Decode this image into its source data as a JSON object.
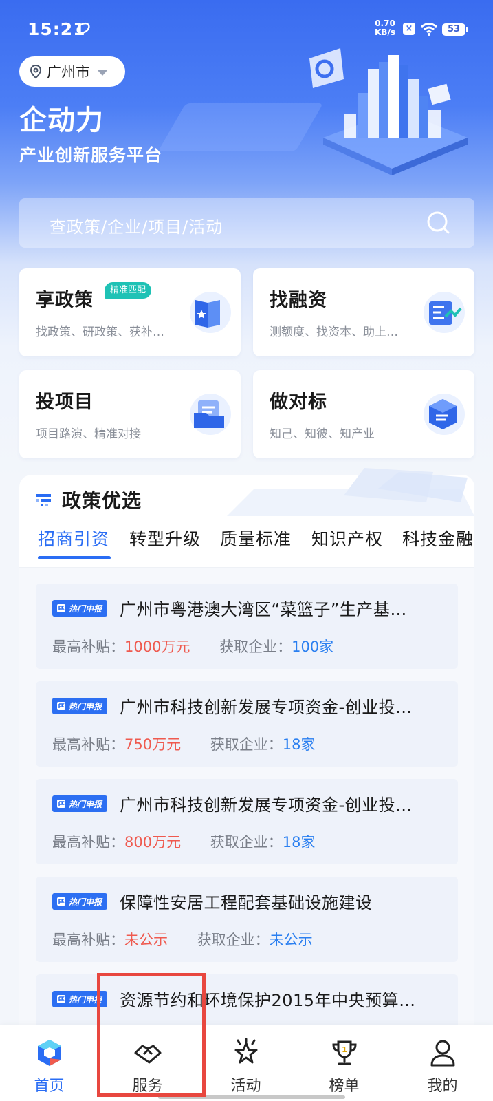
{
  "status_bar": {
    "time": "15:21",
    "net_speed": "0.70",
    "net_unit": "KB/s",
    "battery": "53"
  },
  "header": {
    "city": "广州市",
    "app_name": "企动力",
    "tagline": "产业创新服务平台"
  },
  "search": {
    "placeholder": "查政策/企业/项目/活动"
  },
  "features": [
    {
      "title": "享政策",
      "badge": "精准匹配",
      "desc": "找政策、研政策、获补…",
      "icon": "policy-book-icon"
    },
    {
      "title": "找融资",
      "desc": "测额度、找资本、助上…",
      "icon": "finance-icon"
    },
    {
      "title": "投项目",
      "desc": "项目路演、精准对接",
      "icon": "project-folder-icon"
    },
    {
      "title": "做对标",
      "desc": "知己、知彼、知产业",
      "icon": "benchmark-icon"
    }
  ],
  "policy_section": {
    "title": "政策优选",
    "tabs": [
      "招商引资",
      "转型升级",
      "质量标准",
      "知识产权",
      "科技金融"
    ],
    "active_tab": "招商引资",
    "hot_tag": "热门申报",
    "subsidy_label": "最高补贴：",
    "company_label": "获取企业：",
    "items": [
      {
        "title": "广州市粤港澳大湾区“菜篮子”生产基…",
        "subsidy": "1000万元",
        "companies": "100家"
      },
      {
        "title": "广州市科技创新发展专项资金-创业投…",
        "subsidy": "750万元",
        "companies": "18家"
      },
      {
        "title": "广州市科技创新发展专项资金-创业投…",
        "subsidy": "800万元",
        "companies": "18家"
      },
      {
        "title": "保障性安居工程配套基础设施建设",
        "subsidy": "未公示",
        "companies": "未公示"
      },
      {
        "title": "资源节约和环境保护2015年中央预算…",
        "subsidy": "",
        "companies": ""
      }
    ]
  },
  "bottom_nav": [
    {
      "label": "首页",
      "icon": "home-logo-icon",
      "active": true
    },
    {
      "label": "服务",
      "icon": "handshake-icon",
      "active": false
    },
    {
      "label": "活动",
      "icon": "activity-star-icon",
      "active": false
    },
    {
      "label": "榜单",
      "icon": "trophy-icon",
      "active": false
    },
    {
      "label": "我的",
      "icon": "profile-icon",
      "active": false
    }
  ],
  "colors": {
    "brand_blue": "#2a6df4",
    "accent_red": "#ef5a4f",
    "badge_teal": "#1fc2b5",
    "highlight_box": "#e8473f"
  }
}
